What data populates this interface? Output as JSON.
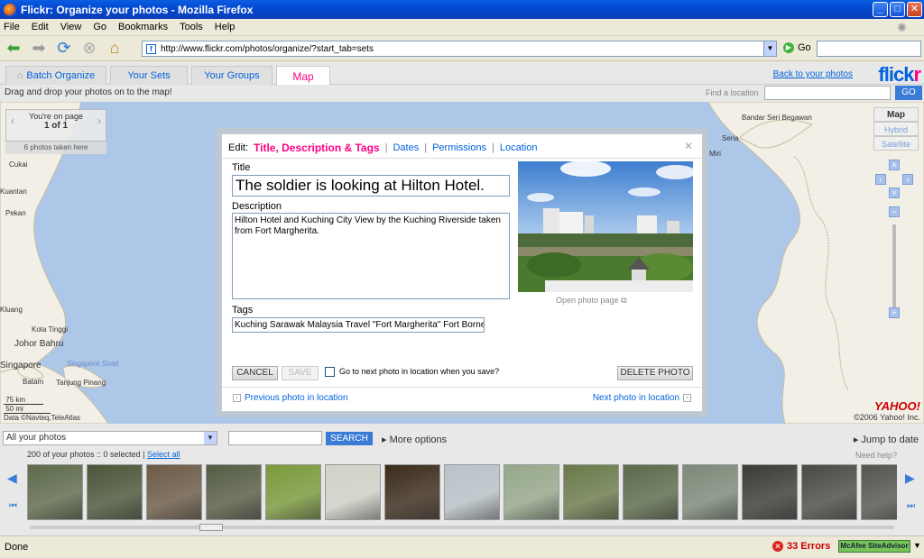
{
  "window": {
    "title": "Flickr: Organize your photos - Mozilla Firefox"
  },
  "menu": [
    "File",
    "Edit",
    "View",
    "Go",
    "Bookmarks",
    "Tools",
    "Help"
  ],
  "nav": {
    "url": "http://www.flickr.com/photos/organize/?start_tab=sets",
    "go_label": "Go"
  },
  "flickr": {
    "tabs": [
      "Batch Organize",
      "Your Sets",
      "Your Groups",
      "Map"
    ],
    "back_link": "Back to your photos",
    "logo_a": "flick",
    "logo_b": "r",
    "hint": "Drag and drop your photos on to the map!",
    "find_label": "Find a location",
    "find_go": "GO"
  },
  "map": {
    "page_line1": "You're on page",
    "page_line2": "1 of 1",
    "photos_taken": "6 photos taken here",
    "types": [
      "Map",
      "Hybrid",
      "Satellite"
    ],
    "labels": [
      "Cukai",
      "Kuantan",
      "Pekan",
      "Kluang",
      "Kota Tinggi",
      "Johor Bahru",
      "Singapore",
      "Batam",
      "Tanjung Pinang",
      "Singapore Strait",
      "Seria",
      "Bandar Seri Begawan",
      "Miri"
    ],
    "scale_km": "75 km",
    "scale_mi": "50 mi",
    "data_credit": "Data ©Navteq,TeleAtlas",
    "yahoo": "YAHOO!",
    "copyright": "©2006 Yahoo! Inc."
  },
  "dialog": {
    "edit_label": "Edit:",
    "tabs": [
      "Title, Description & Tags",
      "Dates",
      "Permissions",
      "Location"
    ],
    "title_label": "Title",
    "title_value": "The soldier is looking at Hilton Hotel.",
    "desc_label": "Description",
    "desc_value": "Hilton Hotel and Kuching City View by the Kuching Riverside taken from Fort Margherita.",
    "tags_label": "Tags",
    "tags_value": "Kuching Sarawak Malaysia Travel \"Fort Margherita\" Fort Borneo",
    "open_photo": "Open photo page",
    "cancel": "CANCEL",
    "save": "SAVE",
    "next_checkbox": "Go to next photo in location when you save?",
    "delete": "DELETE PHOTO",
    "prev_link": "Previous photo in location",
    "next_link": "Next photo in location"
  },
  "organizer": {
    "filter": "All your photos",
    "search_btn": "SEARCH",
    "more_options": "More options",
    "jump_to_date": "Jump to date",
    "counts": "200 of your photos :: 0 selected |",
    "select_all": "Select all",
    "need_help": "Need help?",
    "thumb_colors": [
      "#5d6a4a",
      "#4a5538",
      "#6b5a45",
      "#555c43",
      "#7a9a3a",
      "#cfd3c7",
      "#3a2a1a",
      "#b9c3c8",
      "#96a88a",
      "#6a7a4a",
      "#5a6a4a",
      "#7c8a78",
      "#3a3a35",
      "#4a4a45",
      "#555550"
    ]
  },
  "status": {
    "done": "Done",
    "errors": "33 Errors",
    "mcafee": "McAfee SiteAdvisor"
  }
}
